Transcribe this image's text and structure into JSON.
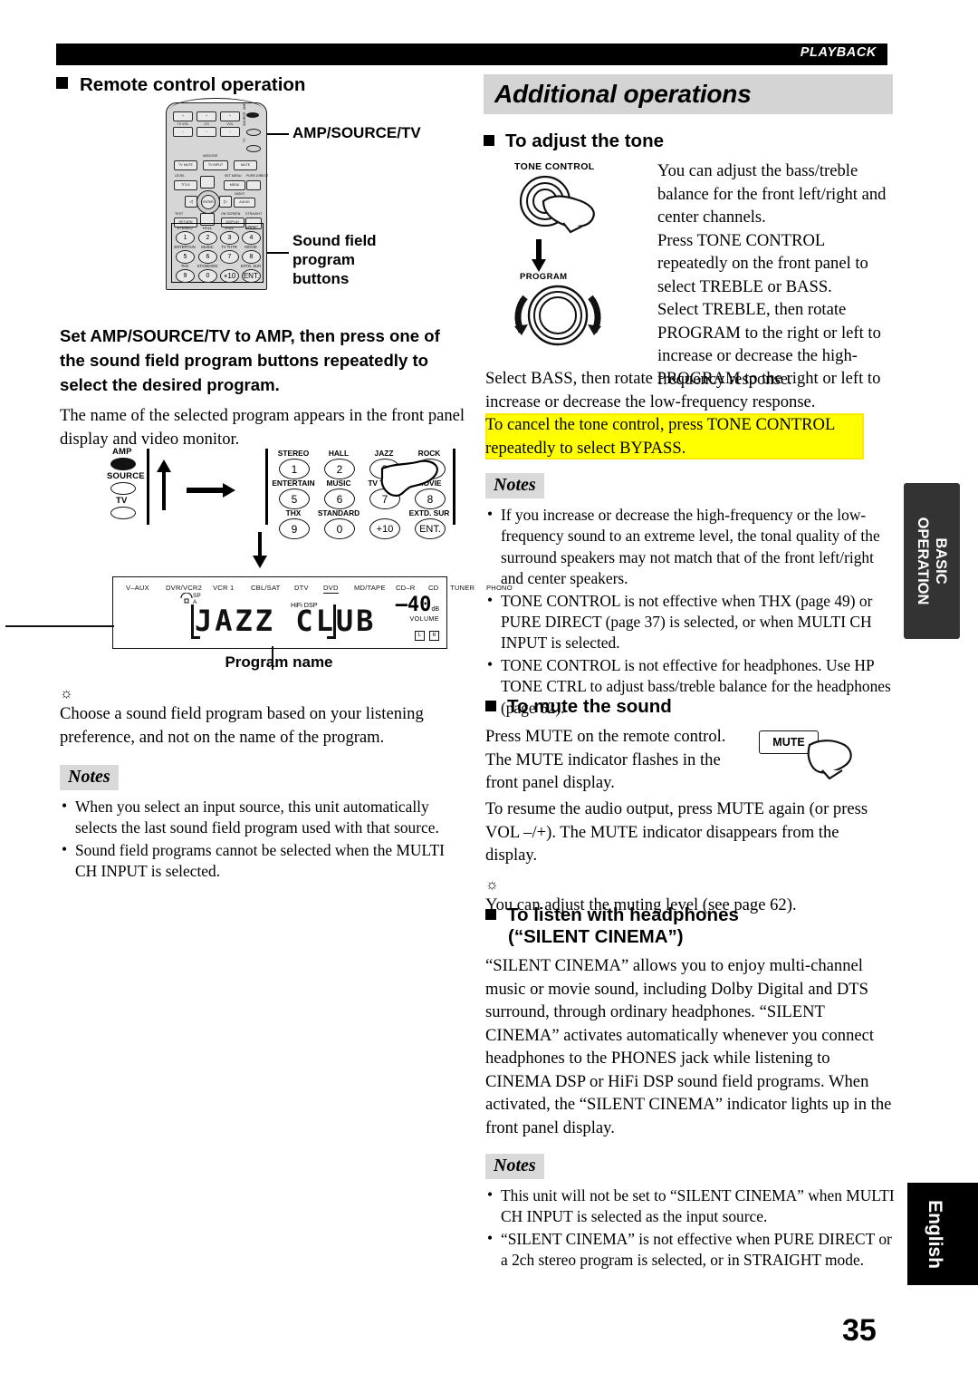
{
  "header": {
    "tag": "PLAYBACK"
  },
  "page_number": "35",
  "side_tabs": {
    "basic_operation": "BASIC\nOPERATION",
    "basic_operation_line1": "BASIC",
    "basic_operation_line2": "OPERATION",
    "language": "English"
  },
  "left_column": {
    "heading": "Remote control operation",
    "remote_callouts": {
      "amp_source_tv": "AMP/SOURCE/TV",
      "sound_field_line1": "Sound field",
      "sound_field_line2": "program",
      "sound_field_line3": "buttons"
    },
    "remote": {
      "top_buttons": [
        "TV VOL",
        "CH",
        "VOL"
      ],
      "plus": "+",
      "minus": "–",
      "side_buttons": [
        "AMP",
        "SOURCE",
        "TV"
      ],
      "abcde": "A/B/C/D/E",
      "row2": [
        "TV MUTE",
        "TV INPUT",
        "MUTE"
      ],
      "level": "LEVEL",
      "title": "TITLE",
      "set_menu": "SET MENU",
      "menu": "MENU",
      "pure_direct": "PURE DIRECT",
      "night": "NIGHT",
      "audio": "AUDIO",
      "test": "TEST",
      "return": "RETURN",
      "on_screen": "ON SCREEN",
      "display": "DISPLAY",
      "straight": "STRAIGHT",
      "effect": "EFFECT",
      "enter": "ENTER",
      "numpad_labels": [
        "STEREO",
        "HALL",
        "JAZZ",
        "ROCK",
        "ENTERTAIN",
        "MUSIC",
        "TV THTR",
        "MOVIE",
        "THX",
        "STANDARD",
        "",
        "EXTD. SUR"
      ],
      "numpad_keys": [
        "1",
        "2",
        "3",
        "4",
        "5",
        "6",
        "7",
        "8",
        "9",
        "0",
        "+10",
        "ENT."
      ]
    },
    "instruction_bold": "Set AMP/SOURCE/TV to AMP, then press one of the sound field program buttons repeatedly to select the desired program.",
    "instruction_body": "The name of the selected program appears in the front panel display and video monitor.",
    "step_diagram": {
      "mode_labels": [
        "AMP",
        "SOURCE",
        "TV"
      ],
      "key_labels": [
        "STEREO",
        "HALL",
        "JAZZ",
        "ROCK",
        "ENTERTAIN",
        "MUSIC",
        "TV THTR",
        "MOVIE",
        "THX",
        "STANDARD",
        "",
        "EXTD. SUR"
      ],
      "keys": [
        "1",
        "2",
        "3",
        "4",
        "5",
        "6",
        "7",
        "8",
        "9",
        "0",
        "+10",
        "ENT."
      ]
    },
    "front_panel_display": {
      "sources": [
        "V–AUX",
        "DVR/VCR2",
        "VCR 1",
        "CBL/SAT",
        "DTV",
        "DVD",
        "MD/TAPE",
        "CD–R",
        "CD",
        "TUNER",
        "PHONO"
      ],
      "sp_a": "SP",
      "sp_a2": "A",
      "hifi_dsp": "HiFi DSP",
      "program_text": "JAZZ CLUB",
      "volume_value": "–40",
      "volume_decimal": "0",
      "db": "dB",
      "volume_word": "VOLUME",
      "indicator_l": "L",
      "indicator_r": "R",
      "caption": "Program name"
    },
    "tip_text": "Choose a sound field program based on your listening preference, and not on the name of the program.",
    "notes_label": "Notes",
    "notes": [
      "When you select an input source, this unit automatically selects the last sound field program used with that source.",
      "Sound field programs cannot be selected when the MULTI CH INPUT is selected."
    ]
  },
  "right_column": {
    "banner_title": "Additional operations",
    "tone": {
      "heading": "To adjust the tone",
      "tone_control_label": "TONE CONTROL",
      "program_label": "PROGRAM",
      "para1": "You can adjust the bass/treble balance for the front left/right and center channels.",
      "para2": "Press TONE CONTROL repeatedly on the front panel to select TREBLE or BASS.",
      "para3": "Select TREBLE, then rotate PROGRAM to the right or left to increase or decrease the high-frequency response.",
      "para4": "Select BASS, then rotate PROGRAM to the right or left to increase or decrease the low-frequency response.",
      "highlighted": "To cancel the tone control, press TONE CONTROL repeatedly to select BYPASS.",
      "notes_label": "Notes",
      "notes": [
        "If you increase or decrease the high-frequency or the low-frequency sound to an extreme level, the tonal quality of the surround speakers may not match that of the front left/right and center speakers.",
        "TONE CONTROL is not effective when THX (page 49) or PURE DIRECT (page 37) is selected, or when MULTI CH INPUT is selected.",
        "TONE CONTROL is not effective for headphones. Use HP TONE CTRL to adjust bass/treble balance for the headphones (page 62)."
      ]
    },
    "mute": {
      "heading": "To mute the sound",
      "button_label": "MUTE",
      "para1": "Press MUTE on the remote control. The MUTE indicator flashes in the front panel display.",
      "para2": "To resume the audio output, press MUTE again (or press VOL –/+). The MUTE indicator disappears from the display.",
      "tip": "You can adjust the muting level (see page 62)."
    },
    "silent_cinema": {
      "heading_line1": "To listen with headphones",
      "heading_line2": "(“SILENT CINEMA”)",
      "para": "“SILENT CINEMA” allows you to enjoy multi-channel music or movie sound, including Dolby Digital and DTS surround, through ordinary headphones. “SILENT CINEMA” activates automatically whenever you connect headphones to the PHONES jack while listening to CINEMA DSP or HiFi DSP sound field programs. When activated, the “SILENT CINEMA” indicator lights up in the front panel display.",
      "notes_label": "Notes",
      "notes": [
        "This unit will not be set to “SILENT CINEMA” when MULTI CH INPUT is selected as the input source.",
        "“SILENT CINEMA” is not effective when PURE DIRECT or a 2ch stereo program is selected, or in STRAIGHT mode."
      ]
    }
  },
  "colors": {
    "bar": "#000000",
    "banner": "#d4d4d4",
    "notes_badge": "#d9d9d9",
    "highlight": "#ffff00",
    "tab_basic": "#333333",
    "tab_english": "#000000"
  }
}
